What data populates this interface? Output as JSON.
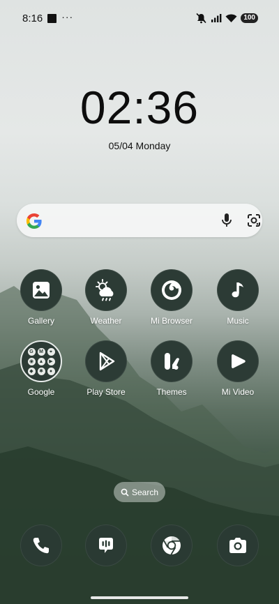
{
  "status_bar": {
    "time": "8:16",
    "overflow": "···",
    "battery": "100",
    "icons": [
      "notification-square-icon",
      "mute-icon",
      "signal-icon",
      "wifi-icon",
      "battery-icon"
    ]
  },
  "clock": {
    "time": "02:36",
    "date": "05/04 Monday"
  },
  "search_bar": {
    "icons": [
      "google-g-icon",
      "microphone-icon",
      "google-lens-icon"
    ]
  },
  "apps": [
    {
      "label": "Gallery",
      "icon": "gallery-icon"
    },
    {
      "label": "Weather",
      "icon": "weather-icon"
    },
    {
      "label": "Mi Browser",
      "icon": "mi-browser-icon"
    },
    {
      "label": "Music",
      "icon": "music-note-icon"
    },
    {
      "label": "Google",
      "icon": "google-folder-icon",
      "folder_items": [
        "G",
        "M",
        "⌖",
        "◉",
        "▲",
        "▶",
        "◆",
        "✱",
        "●"
      ]
    },
    {
      "label": "Play Store",
      "icon": "play-store-icon"
    },
    {
      "label": "Themes",
      "icon": "themes-icon"
    },
    {
      "label": "Mi Video",
      "icon": "mi-video-icon"
    }
  ],
  "search_pill": {
    "label": "Search",
    "icon": "search-icon"
  },
  "dock": [
    {
      "icon": "phone-icon",
      "app": "Phone"
    },
    {
      "icon": "messages-icon",
      "app": "Messages"
    },
    {
      "icon": "chrome-icon",
      "app": "Chrome"
    },
    {
      "icon": "camera-icon",
      "app": "Camera"
    }
  ],
  "colors": {
    "icon_bg": "#2c3b35",
    "icon_fg": "#ffffff"
  }
}
